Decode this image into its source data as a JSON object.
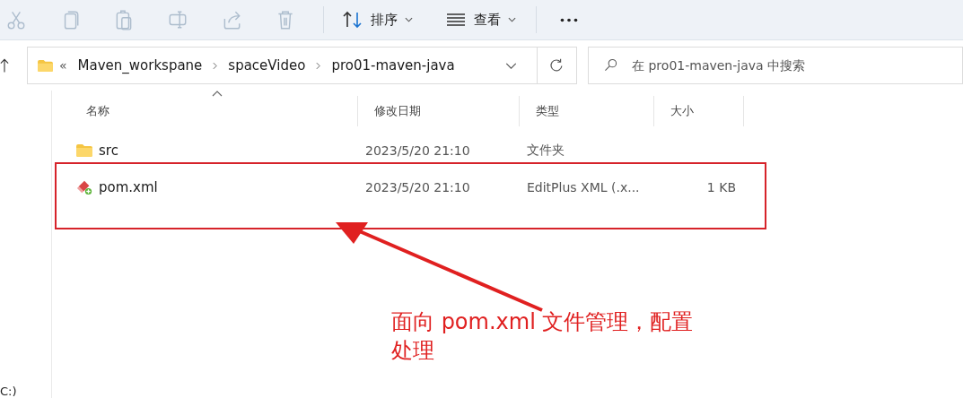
{
  "toolbar": {
    "actions": [
      {
        "kind": "cut",
        "disabled": true
      },
      {
        "kind": "copy",
        "disabled": true
      },
      {
        "kind": "paste",
        "disabled": true
      },
      {
        "kind": "rename",
        "disabled": true
      },
      {
        "kind": "share",
        "disabled": true
      },
      {
        "kind": "delete",
        "disabled": true
      }
    ],
    "sort": {
      "label": "排序"
    },
    "view": {
      "label": "查看"
    }
  },
  "address": {
    "overflow": "«",
    "crumbs": [
      "Maven_workspane",
      "spaceVideo",
      "pro01-maven-java"
    ]
  },
  "search": {
    "placeholder": "在 pro01-maven-java 中搜索"
  },
  "columns": [
    {
      "label": "名称",
      "sorted": true
    },
    {
      "label": "修改日期",
      "sorted": false
    },
    {
      "label": "类型",
      "sorted": false
    },
    {
      "label": "大小",
      "sorted": false
    }
  ],
  "rows": [
    {
      "kind": "folder",
      "name": "src",
      "modified": "2023/5/20 21:10",
      "type": "文件夹"
    },
    {
      "kind": "xml",
      "name": "pom.xml",
      "modified": "2023/5/20 21:10",
      "type": "EditPlus XML (.x...",
      "size": "1 KB"
    }
  ],
  "nav": {
    "drive": "C:)"
  },
  "annotation": {
    "lines": [
      "面向 pom.xml 文件管理，配置",
      "处理"
    ]
  }
}
